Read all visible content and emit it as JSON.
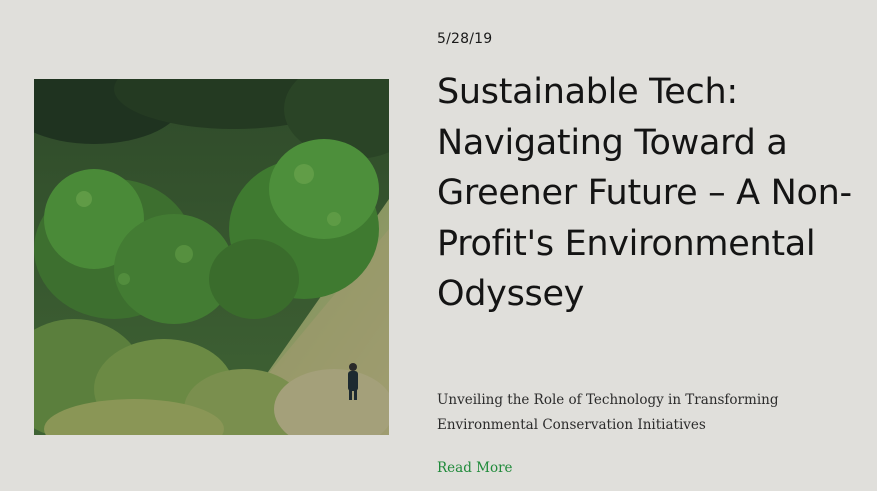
{
  "post": {
    "date": "5/28/19",
    "title": "Sustainable Tech: Navigating Toward a Greener Future – A Non-Profit's Environmental Odyssey",
    "subtitle": "Unveiling the Role of Technology in Transforming Environmental Conservation Initiatives",
    "read_more_label": "Read More",
    "image": {
      "subject": "green hillside with dense vegetation and a hiker on a trail"
    }
  },
  "colors": {
    "background": "#e0dfdb",
    "text": "#141414",
    "link": "#1f8a3a"
  }
}
